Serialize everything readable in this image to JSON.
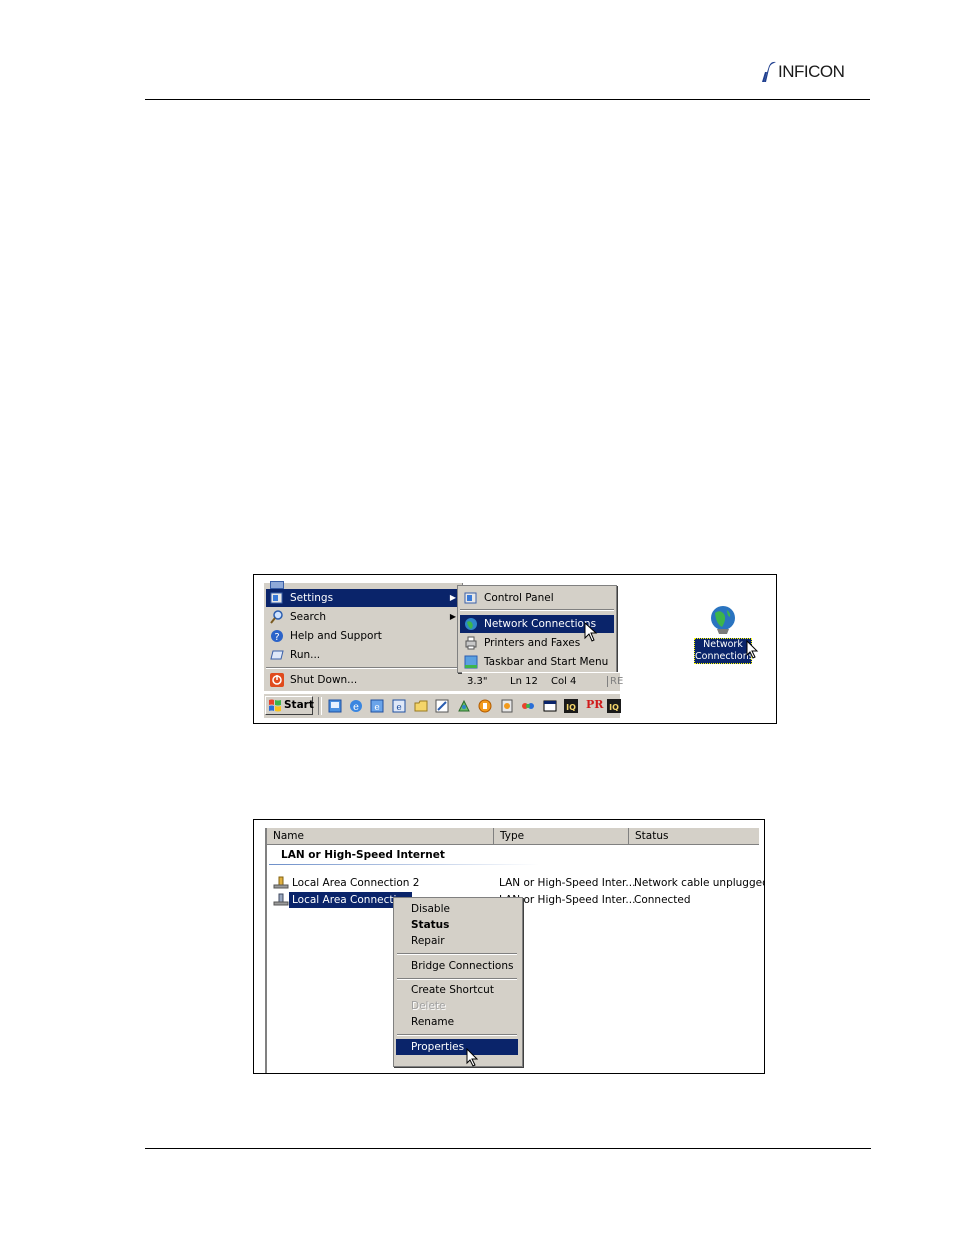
{
  "header": {
    "logo_text": "INFICON"
  },
  "figure1": {
    "start_menu": {
      "items": [
        {
          "label": "Settings",
          "submenu": true,
          "selected": true
        },
        {
          "label": "Search",
          "submenu": true
        },
        {
          "label": "Help and Support"
        },
        {
          "label": "Run..."
        },
        {
          "label": "Shut Down..."
        }
      ]
    },
    "settings_submenu": {
      "items": [
        {
          "label": "Control Panel"
        },
        {
          "label": "Network Connections",
          "selected": true
        },
        {
          "label": "Printers and Faxes"
        },
        {
          "label": "Taskbar and Start Menu"
        }
      ]
    },
    "statusbar": {
      "size": "3.3\"",
      "line": "Ln  12",
      "col": "Col  4",
      "rec": "RE"
    },
    "taskbar": {
      "start_label": "Start",
      "pr_label": "PR"
    },
    "desktop_icon": {
      "line1": "Network",
      "line2": "Connections"
    }
  },
  "figure2": {
    "columns": [
      "Name",
      "Type",
      "Status"
    ],
    "group_title": "LAN or High-Speed Internet",
    "rows": [
      {
        "name": "Local Area Connection 2",
        "type": "LAN or High-Speed Inter...",
        "status": "Network cable unplugged"
      },
      {
        "name": "Local Area Connection",
        "type": "LAN or High-Speed Inter...",
        "status": "Connected"
      }
    ],
    "context_menu": {
      "disable": "Disable",
      "status": "Status",
      "repair": "Repair",
      "bridge": "Bridge Connections",
      "shortcut": "Create Shortcut",
      "delete": "Delete",
      "rename": "Rename",
      "properties": "Properties"
    }
  },
  "colors": {
    "selection": "#0a246a",
    "menu_face": "#d4d0c8"
  }
}
